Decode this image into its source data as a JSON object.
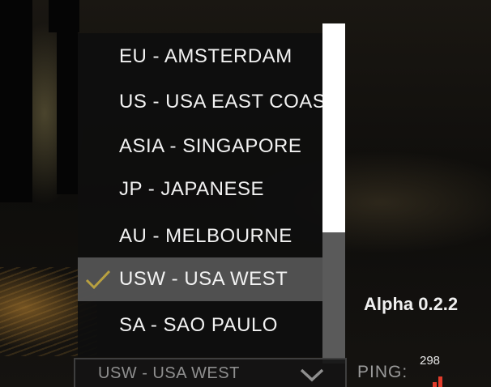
{
  "region_menu": {
    "items": [
      {
        "label": "EU - AMSTERDAM",
        "selected": false
      },
      {
        "label": "US - USA EAST COAST",
        "selected": false
      },
      {
        "label": "ASIA - SINGAPORE",
        "selected": false
      },
      {
        "label": "JP - JAPANESE",
        "selected": false
      },
      {
        "label": "AU - MELBOURNE",
        "selected": false
      },
      {
        "label": "USW - USA WEST",
        "selected": true
      },
      {
        "label": "SA - SAO PAULO",
        "selected": false
      }
    ],
    "selected_icon": "checkmark-icon",
    "accent_color": "#b8a040"
  },
  "region_select": {
    "value": "USW - USA WEST",
    "icon": "chevron-down-icon"
  },
  "version": "Alpha 0.2.2",
  "ping": {
    "label": "PING:",
    "value": "298",
    "icon": "signal-bars-icon",
    "color": "#e23b2b"
  }
}
